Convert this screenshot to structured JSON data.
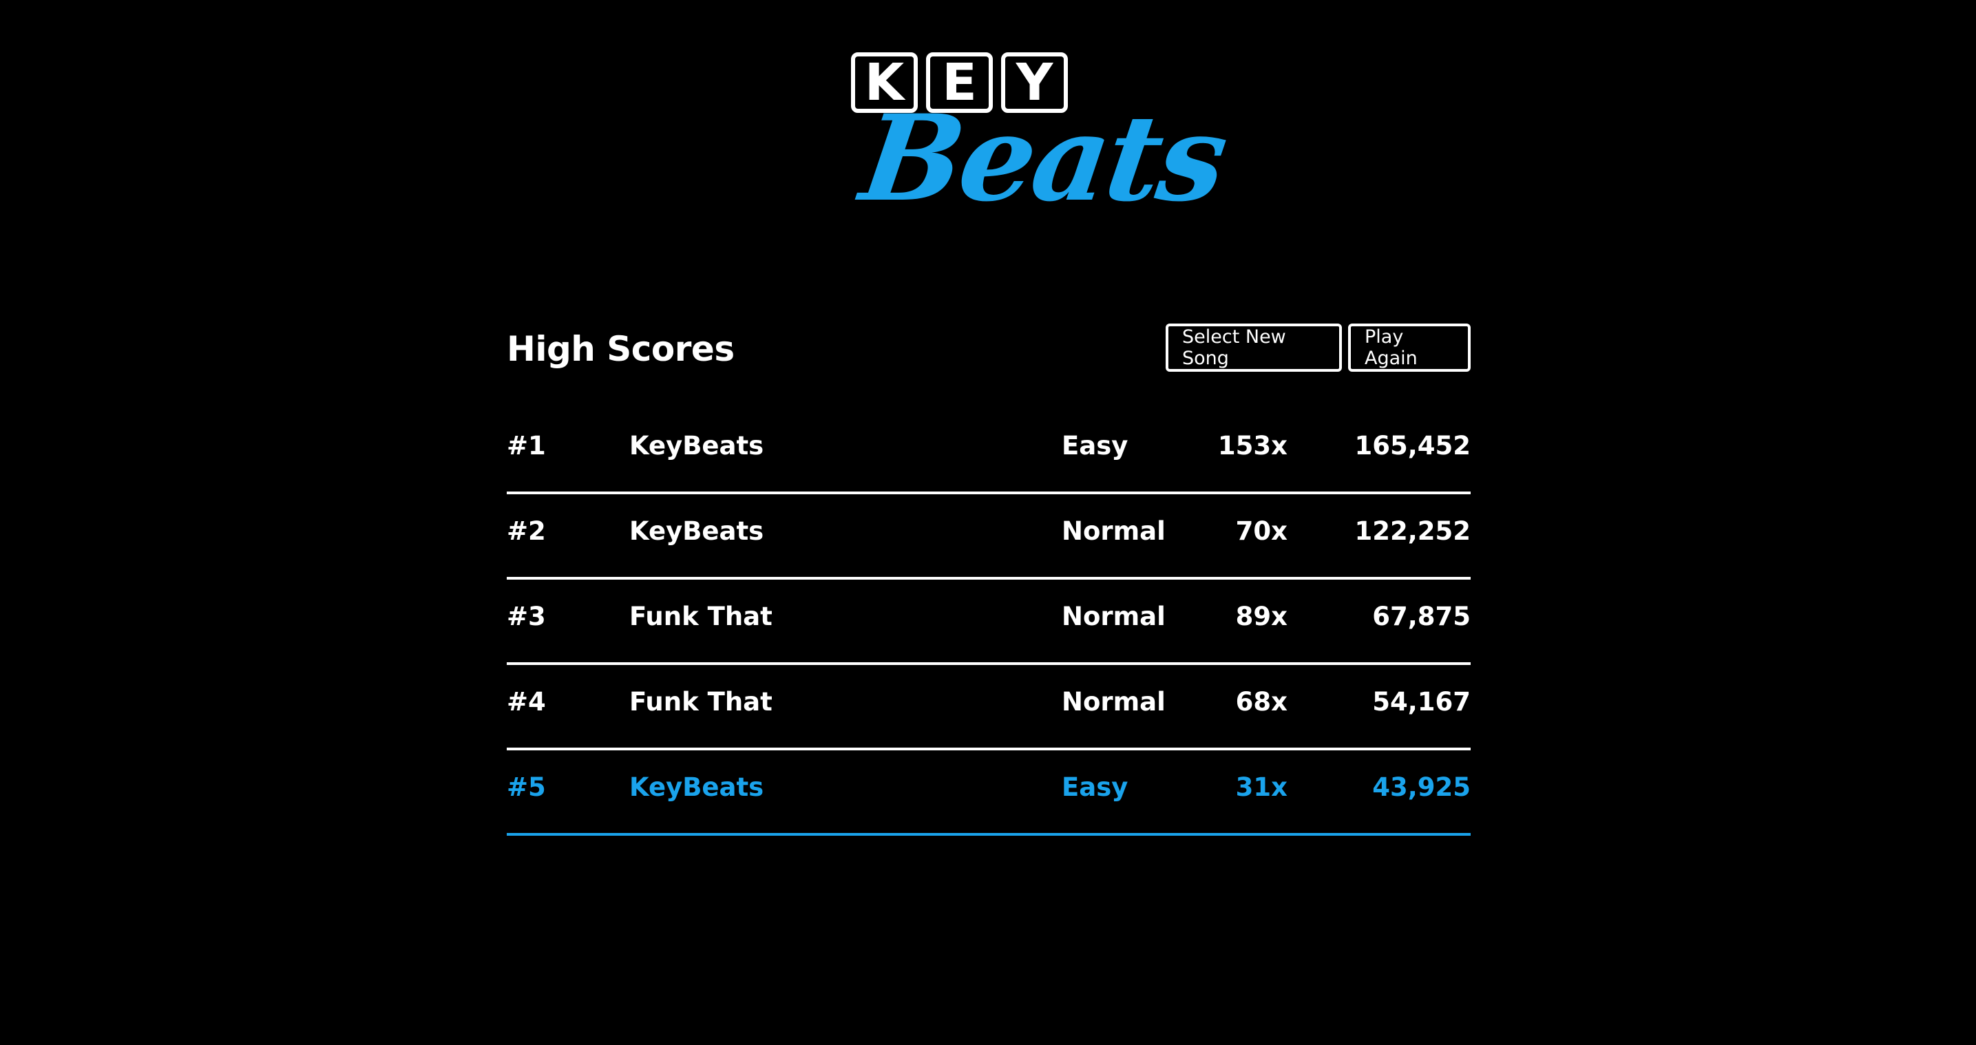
{
  "logo": {
    "key_letters": [
      "K",
      "E",
      "Y"
    ],
    "beats_text": "Beats",
    "accent_color": "#1aa3ec"
  },
  "scores": {
    "title": "High Scores",
    "buttons": {
      "select_new_song": "Select New Song",
      "play_again": "Play Again"
    },
    "rows": [
      {
        "rank": "#1",
        "song": "KeyBeats",
        "difficulty": "Easy",
        "multiplier": "153x",
        "score": "165,452",
        "current": false
      },
      {
        "rank": "#2",
        "song": "KeyBeats",
        "difficulty": "Normal",
        "multiplier": "70x",
        "score": "122,252",
        "current": false
      },
      {
        "rank": "#3",
        "song": "Funk That",
        "difficulty": "Normal",
        "multiplier": "89x",
        "score": "67,875",
        "current": false
      },
      {
        "rank": "#4",
        "song": "Funk That",
        "difficulty": "Normal",
        "multiplier": "68x",
        "score": "54,167",
        "current": false
      },
      {
        "rank": "#5",
        "song": "KeyBeats",
        "difficulty": "Easy",
        "multiplier": "31x",
        "score": "43,925",
        "current": true
      }
    ]
  },
  "colors": {
    "background": "#000000",
    "text": "#ffffff",
    "highlight": "#1aa3ec"
  }
}
